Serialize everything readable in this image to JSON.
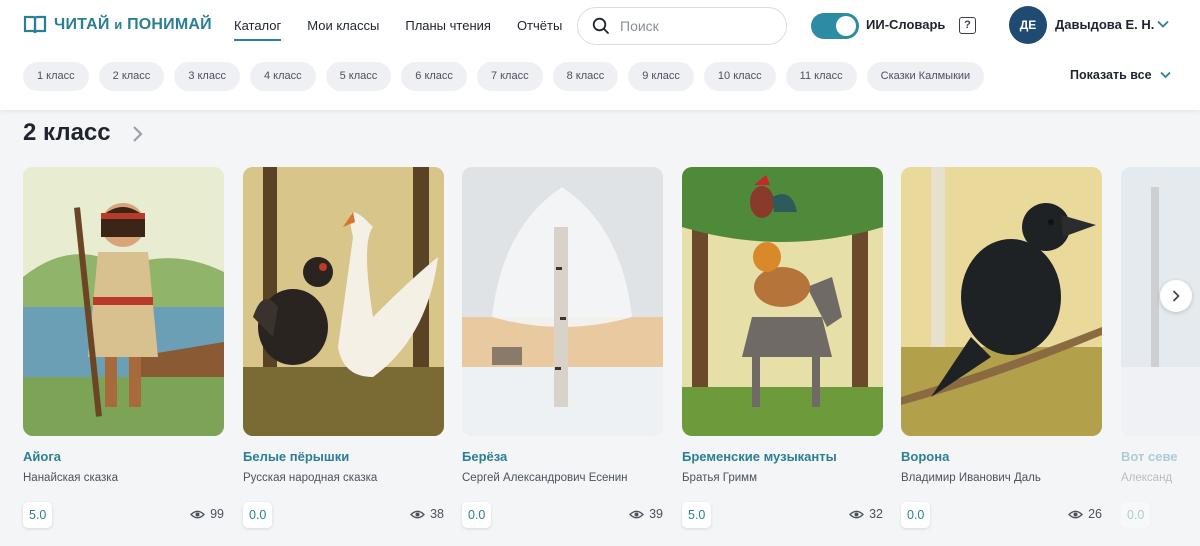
{
  "header": {
    "logo_text": "ЧИТАЙ",
    "logo_conj": "и",
    "logo_text2": "ПОНИМАЙ",
    "nav": [
      {
        "label": "Каталог",
        "active": true
      },
      {
        "label": "Мои классы",
        "active": false
      },
      {
        "label": "Планы чтения",
        "active": false
      },
      {
        "label": "Отчёты",
        "active": false
      }
    ],
    "search_placeholder": "Поиск",
    "ai_dictionary_label": "ИИ-Словарь",
    "ai_dictionary_on": true,
    "help_label": "?",
    "user_initials": "ДЕ",
    "user_name": "Давыдова Е. Н."
  },
  "grades": [
    "1 класс",
    "2 класс",
    "3 класс",
    "4 класс",
    "5 класс",
    "6 класс",
    "7 класс",
    "8 класс",
    "9 класс",
    "10 класс",
    "11 класс",
    "Сказки Калмыкии"
  ],
  "show_all_label": "Показать все",
  "section": {
    "title": "2 класс"
  },
  "books": [
    {
      "title": "Айога",
      "author": "Нанайская сказка",
      "rating": "5.0",
      "views": "99"
    },
    {
      "title": "Белые пёрышки",
      "author": "Русская народная сказка",
      "rating": "0.0",
      "views": "38"
    },
    {
      "title": "Берёза",
      "author": "Сергей Александрович Есенин",
      "rating": "0.0",
      "views": "39"
    },
    {
      "title": "Бременские музыканты",
      "author": "Братья Гримм",
      "rating": "5.0",
      "views": "32"
    },
    {
      "title": "Ворона",
      "author": "Владимир Иванович Даль",
      "rating": "0.0",
      "views": "26"
    },
    {
      "title": "Вот севе",
      "author": "Александ",
      "rating": "0.0",
      "views": ""
    }
  ],
  "colors": {
    "accent": "#2b7f94",
    "avatar": "#1f4a72",
    "toggle": "#2b8ca3"
  }
}
